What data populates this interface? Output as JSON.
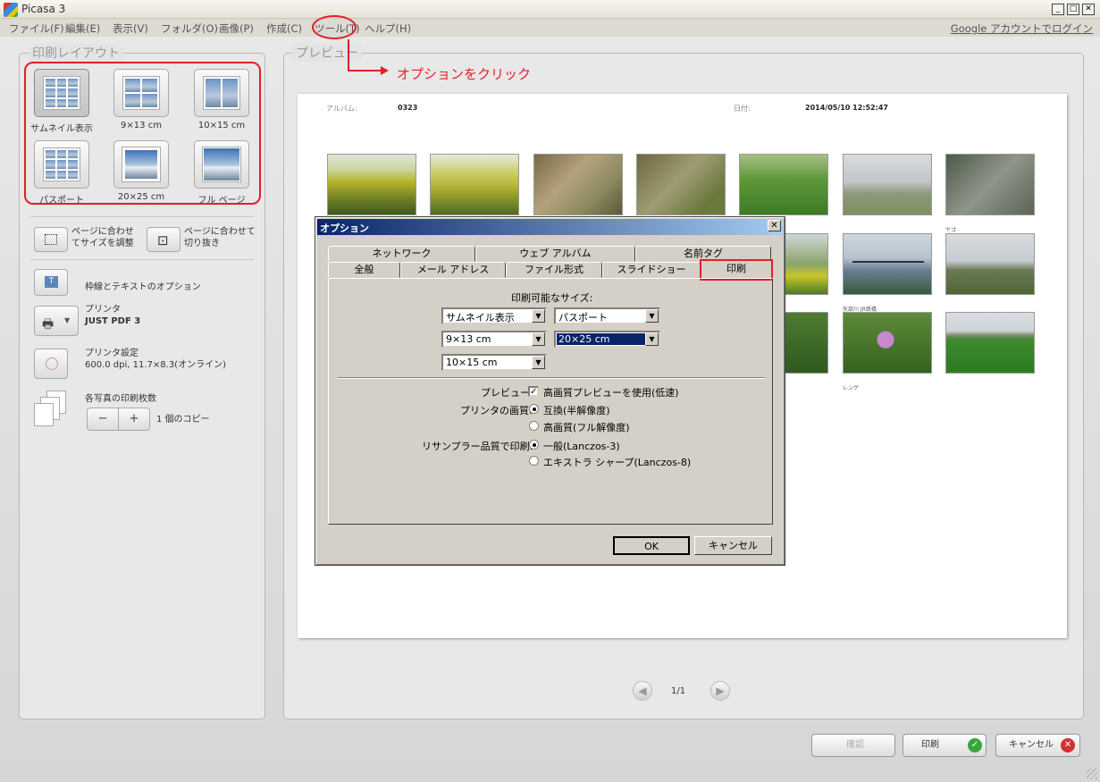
{
  "app": {
    "title": "Picasa 3"
  },
  "menu": [
    "ファイル(F)",
    "編集(E)",
    "表示(V)",
    "フォルダ(O)",
    "画像(P)",
    "作成(C)",
    "ツール(T)",
    "ヘルプ(H)"
  ],
  "login_link": "Google アカウントでログイン",
  "left_panel": {
    "legend": "印刷レイアウト",
    "layouts": [
      "サムネイル表示",
      "9×13 cm",
      "10×15 cm",
      "パスポート",
      "20×25 cm",
      "フル ページ"
    ],
    "fit_adjust": "ページに合わせてサイズを調整",
    "fit_crop": "ページに合わせて切り抜き",
    "border_text": "枠線とテキストのオプション",
    "printer_label": "プリンタ",
    "printer_name": "JUST PDF 3",
    "printer_settings_label": "プリンタ設定",
    "printer_settings_value": "600.0 dpi, 11.7×8.3(オンライン)",
    "copies_label": "各写真の印刷枚数",
    "minus": "−",
    "plus": "+",
    "copies_value": "1 個のコピー"
  },
  "preview": {
    "legend": "プレビュー",
    "album_label": "アルバム:",
    "album_value": "0323",
    "date_label": "日付:",
    "date_value": "2014/05/10 12:52:47",
    "captions": {
      "row1_last": "ヤゴ",
      "row2_caption": "矢部川 JR鉄橋",
      "row3_caption": "レンゲ"
    },
    "page_indicator": "1/1"
  },
  "annotation": {
    "text": "オプションをクリック",
    "color": "#e0202a"
  },
  "bottom_buttons": {
    "confirm": "確認",
    "print": "印刷",
    "cancel": "キャンセル"
  },
  "dialog": {
    "title": "オプション",
    "tabs_row1": [
      "ネットワーク",
      "ウェブ アルバム",
      "名前タグ"
    ],
    "tabs_row2": [
      "全般",
      "メール アドレス",
      "ファイル形式",
      "スライドショー",
      "印刷"
    ],
    "active_tab": "印刷",
    "sizes_label": "印刷可能なサイズ:",
    "size_combos": [
      "サムネイル表示",
      "パスポート",
      "9×13 cm",
      "20×25 cm",
      "10×15 cm"
    ],
    "preview_label": "プレビュー:",
    "preview_option": "高画質プレビューを使用(低速)",
    "quality_label": "プリンタの画質:",
    "quality_options": [
      "互換(半解像度)",
      "高画質(フル解像度)"
    ],
    "resample_label": "リサンプラー品質で印刷:",
    "resample_options": [
      "一般(Lanczos-3)",
      "エキストラ シャープ(Lanczos-8)"
    ],
    "ok": "OK",
    "cancel": "キャンセル"
  }
}
